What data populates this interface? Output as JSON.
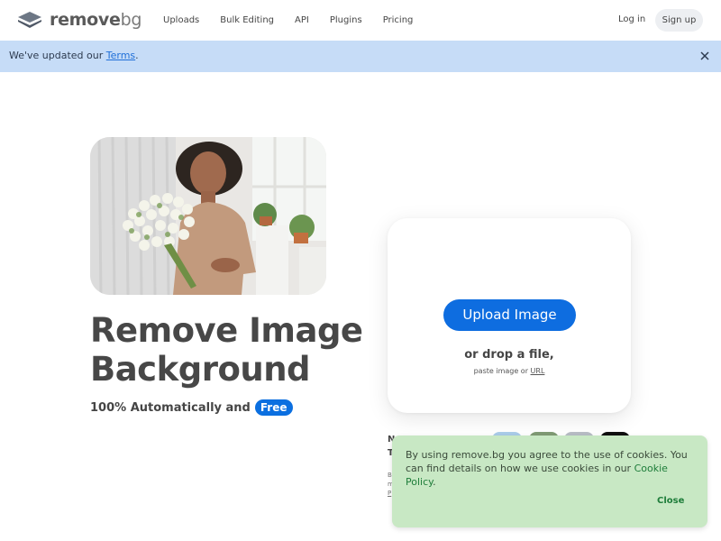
{
  "header": {
    "logo_text": "remove",
    "logo_text_suffix": "bg",
    "nav": [
      "Uploads",
      "Bulk Editing",
      "API",
      "Plugins",
      "Pricing"
    ],
    "login_label": "Log in",
    "signup_label": "Sign up"
  },
  "banner": {
    "text": "We've updated our ",
    "link": "Terms",
    "suffix": "."
  },
  "hero": {
    "title_line1": "Remove Image",
    "title_line2": "Background",
    "subtitle": "100% Automatically and",
    "free_badge": "Free"
  },
  "upload": {
    "button_label": "Upload Image",
    "drop_text": "or drop a file,",
    "paste_text": "paste image or ",
    "paste_url": "URL"
  },
  "partial": {
    "line1": "N",
    "line2": "T",
    "small1": "B",
    "small2": "m",
    "small3": "P"
  },
  "cookie": {
    "text": "By using remove.bg you agree to the use of cookies. You can find details on how we use cookies in our ",
    "link": "Cookie Policy",
    "suffix": ".",
    "close_label": "Close"
  },
  "colors": {
    "accent": "#0e6de0",
    "banner_bg": "#c6dcf7",
    "cookie_bg": "#c8e8c4"
  }
}
